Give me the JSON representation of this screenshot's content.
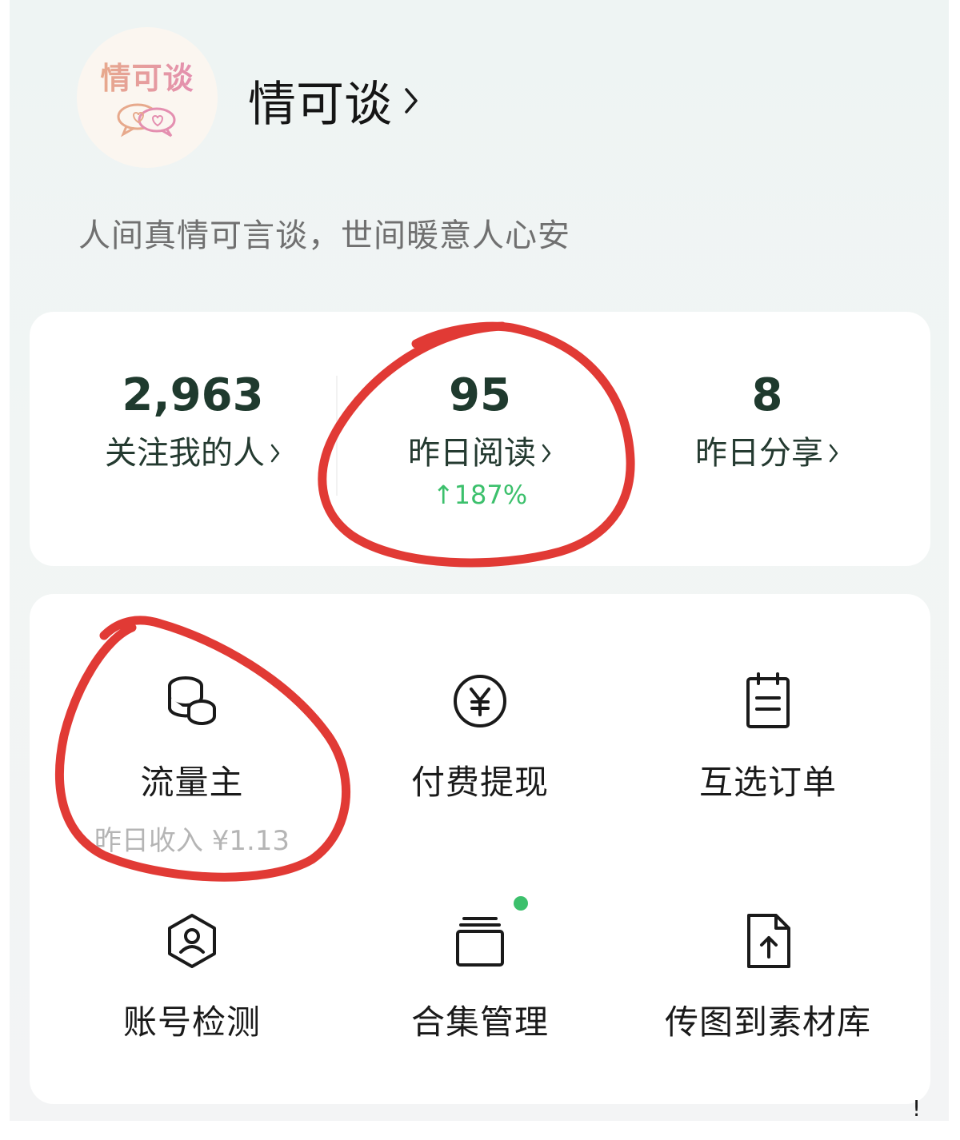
{
  "profile": {
    "avatar_text": "情可谈",
    "name": "情可谈",
    "bio": "人间真情可言谈，世间暖意人心安"
  },
  "stats": [
    {
      "value": "2,963",
      "label": "关注我的人"
    },
    {
      "value": "95",
      "label": "昨日阅读",
      "growth": "↑187%"
    },
    {
      "value": "8",
      "label": "昨日分享"
    }
  ],
  "tools": [
    {
      "label": "流量主",
      "sub": "昨日收入 ¥1.13",
      "icon": "coins-icon"
    },
    {
      "label": "付费提现",
      "icon": "yuan-circle-icon"
    },
    {
      "label": "互选订单",
      "icon": "clipboard-icon"
    },
    {
      "label": "账号检测",
      "icon": "hexagon-user-icon"
    },
    {
      "label": "合集管理",
      "icon": "collection-icon"
    },
    {
      "label": "传图到素材库",
      "icon": "file-upload-icon"
    }
  ],
  "corner_mark": "!",
  "colors": {
    "accent_green": "#3cc06c",
    "annotation_red": "#e13a35",
    "stat_text": "#1f3a2e"
  }
}
